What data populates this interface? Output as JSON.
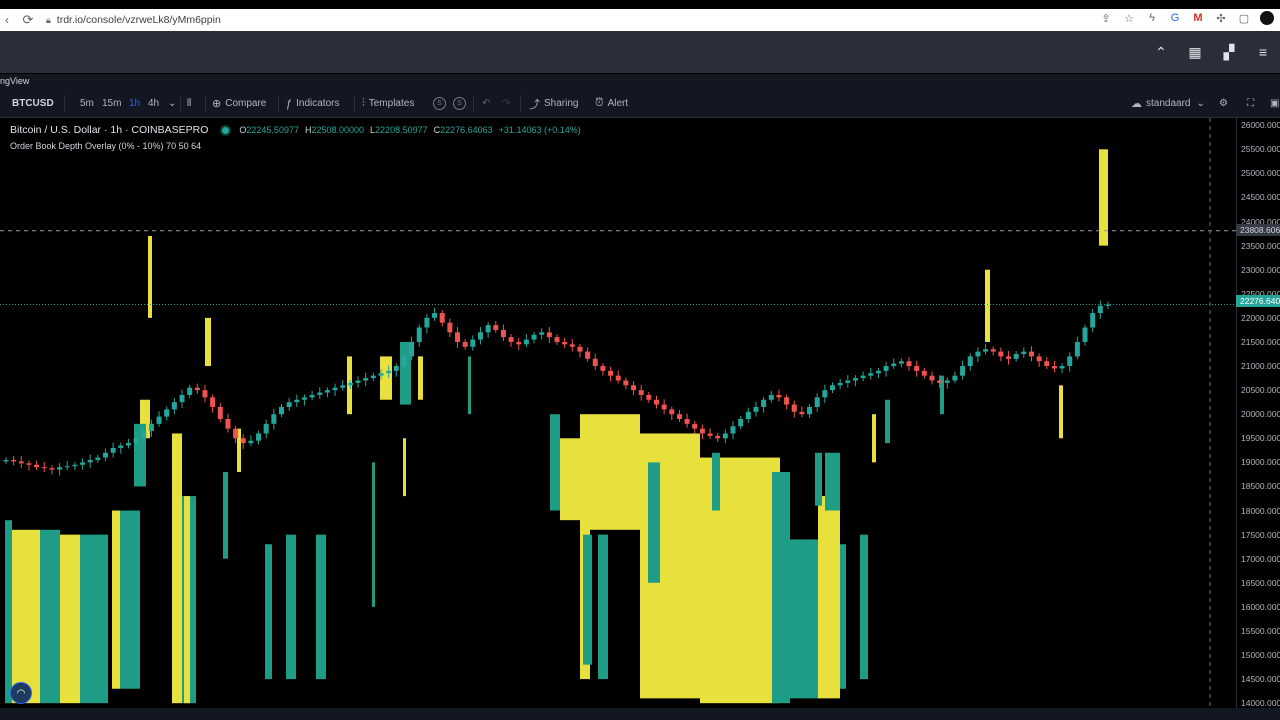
{
  "browser": {
    "url": "trdr.io/console/vzrweLk8/yMm6ppin",
    "icons": [
      "share-icon",
      "star-icon",
      "lightning-icon",
      "translate-icon",
      "gmail-icon",
      "puzzle-icon",
      "sidebar-icon",
      "avatar"
    ]
  },
  "app": {
    "header_icons": [
      "chevron-up-icon",
      "layout-icon",
      "grid-icon",
      "menu-icon"
    ],
    "tv_label": "ngView"
  },
  "toolbar": {
    "symbol": "BTCUSD",
    "intervals": [
      "5m",
      "15m",
      "1h",
      "4h"
    ],
    "active_interval": "1h",
    "compare": "Compare",
    "indicators": "Indicators",
    "templates": "Templates",
    "sharing": "Sharing",
    "alert": "Alert",
    "layout_name": "standaard",
    "circle_a": "S",
    "circle_b": "S"
  },
  "legend": {
    "title": "Bitcoin / U.S. Dollar · 1h · COINBASEPRO",
    "o_label": "O",
    "o": "22245.50977",
    "h_label": "H",
    "h": "22508.00000",
    "l_label": "L",
    "l": "22208.50977",
    "c_label": "C",
    "c": "22276.64063",
    "change": "+31.14063 (+0.14%)",
    "study": "Order Book Depth Overlay (0% - 10%) 70 50 64"
  },
  "price_axis": {
    "ticks": [
      "26000.0000",
      "25500.0000",
      "25000.0000",
      "24500.0000",
      "24000.0000",
      "23500.0000",
      "23000.0000",
      "22500.0000",
      "22000.0000",
      "21500.0000",
      "21000.0000",
      "20500.0000",
      "20000.0000",
      "19500.0000",
      "19000.0000",
      "18500.0000",
      "18000.0000",
      "17500.0000",
      "17000.0000",
      "16500.0000",
      "16000.0000",
      "15500.0000",
      "15000.0000",
      "14500.0000",
      "14000.0000"
    ],
    "current_price": "22276.6406",
    "crosshair_price": "23808.6063"
  },
  "colors": {
    "up": "#26a69a",
    "down": "#ef5350",
    "depth_bid": "#e8e03c",
    "depth_ask": "#1f9c85"
  },
  "chart_data": {
    "type": "candlestick",
    "series": [
      {
        "name": "BTCUSD",
        "close": [
          19050,
          19020,
          18980,
          18950,
          18900,
          18880,
          18850,
          18900,
          18920,
          18950,
          19000,
          19050,
          19100,
          19200,
          19300,
          19350,
          19400,
          19500,
          19650,
          19800,
          19950,
          20100,
          20250,
          20400,
          20550,
          20500,
          20350,
          20150,
          19900,
          19700,
          19500,
          19400,
          19450,
          19600,
          19800,
          20000,
          20150,
          20250,
          20300,
          20350,
          20400,
          20450,
          20500,
          20550,
          20600,
          20650,
          20700,
          20750,
          20800,
          20850,
          20900,
          21000,
          21200,
          21500,
          21800,
          22000,
          22100,
          21900,
          21700,
          21500,
          21400,
          21550,
          21700,
          21850,
          21750,
          21600,
          21500,
          21450,
          21550,
          21650,
          21700,
          21600,
          21500,
          21450,
          21400,
          21300,
          21150,
          21000,
          20900,
          20800,
          20700,
          20600,
          20500,
          20400,
          20300,
          20200,
          20100,
          20000,
          19900,
          19800,
          19700,
          19600,
          19550,
          19500,
          19600,
          19750,
          19900,
          20050,
          20150,
          20300,
          20400,
          20350,
          20200,
          20050,
          20000,
          20150,
          20350,
          20500,
          20600,
          20650,
          20700,
          20750,
          20800,
          20850,
          20900,
          21000,
          21050,
          21100,
          21000,
          20900,
          20800,
          20700,
          20650,
          20700,
          20800,
          21000,
          21200,
          21300,
          21350,
          21300,
          21200,
          21150,
          21250,
          21300,
          21200,
          21100,
          21000,
          20950,
          21000,
          21200,
          21500,
          21800,
          22100,
          22250,
          22276
        ]
      }
    ],
    "ylim": [
      13900,
      26150
    ],
    "x_extent": "recent 1h candles"
  }
}
